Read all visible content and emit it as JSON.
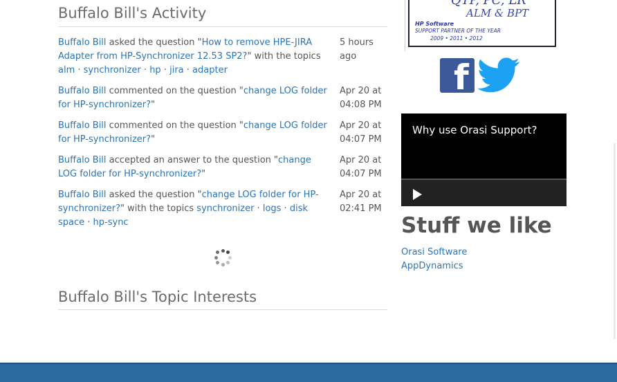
{
  "activity": {
    "title": "Buffalo Bill's Activity",
    "items": [
      {
        "user": "Buffalo Bill",
        "action": " asked the question \"",
        "question": "How to remove HPE-JIRA Adapter from HP-Synchronizer 12.53 SP2?",
        "after": "\" with the topics ",
        "topics": [
          "alm",
          "synchronizer",
          "hp",
          "jira",
          "adapter"
        ],
        "time": "5 hours ago"
      },
      {
        "user": "Buffalo Bill",
        "action": " commented on the question \"",
        "question": "change LOG folder for HP-synchronizer?",
        "after": "\"",
        "topics": [],
        "time": "Apr 20 at 04:08 PM"
      },
      {
        "user": "Buffalo Bill",
        "action": " commented on the question \"",
        "question": "change LOG folder for HP-synchronizer?",
        "after": "\"",
        "topics": [],
        "time": "Apr 20 at 04:07 PM"
      },
      {
        "user": "Buffalo Bill",
        "action": " accepted an answer to the question \"",
        "question": "change LOG folder for HP-synchronizer?",
        "after": "\"",
        "topics": [],
        "time": "Apr 20 at 04:07 PM"
      },
      {
        "user": "Buffalo Bill",
        "action": " asked the question \"",
        "question": "change LOG folder for HP-synchronizer?",
        "after": "\" with the topics ",
        "topics": [
          "synchronizer",
          "logs",
          "disk space",
          "hp-sync"
        ],
        "time": "Apr 20 at 02:41 PM"
      }
    ]
  },
  "interests": {
    "title": "Buffalo Bill's Topic Interests"
  },
  "badge": {
    "line1": "QTP, PC, LR",
    "line2": "ALM & BPT",
    "brand": "HP Software",
    "award": "SUPPORT PARTNER OF THE YEAR",
    "years": "2009 • 2011 • 2012"
  },
  "social": {
    "facebook_icon": "facebook-icon",
    "twitter_icon": "twitter-icon"
  },
  "video": {
    "title": "Why use Orasi Support?"
  },
  "stuff": {
    "title": "Stuff we like",
    "links": [
      "Orasi Software",
      "AppDynamics"
    ]
  },
  "colors": {
    "link": "#2a74b8",
    "footer": "#2a6aa0",
    "facebook": "#3b5998",
    "twitter": "#1da1f2"
  }
}
